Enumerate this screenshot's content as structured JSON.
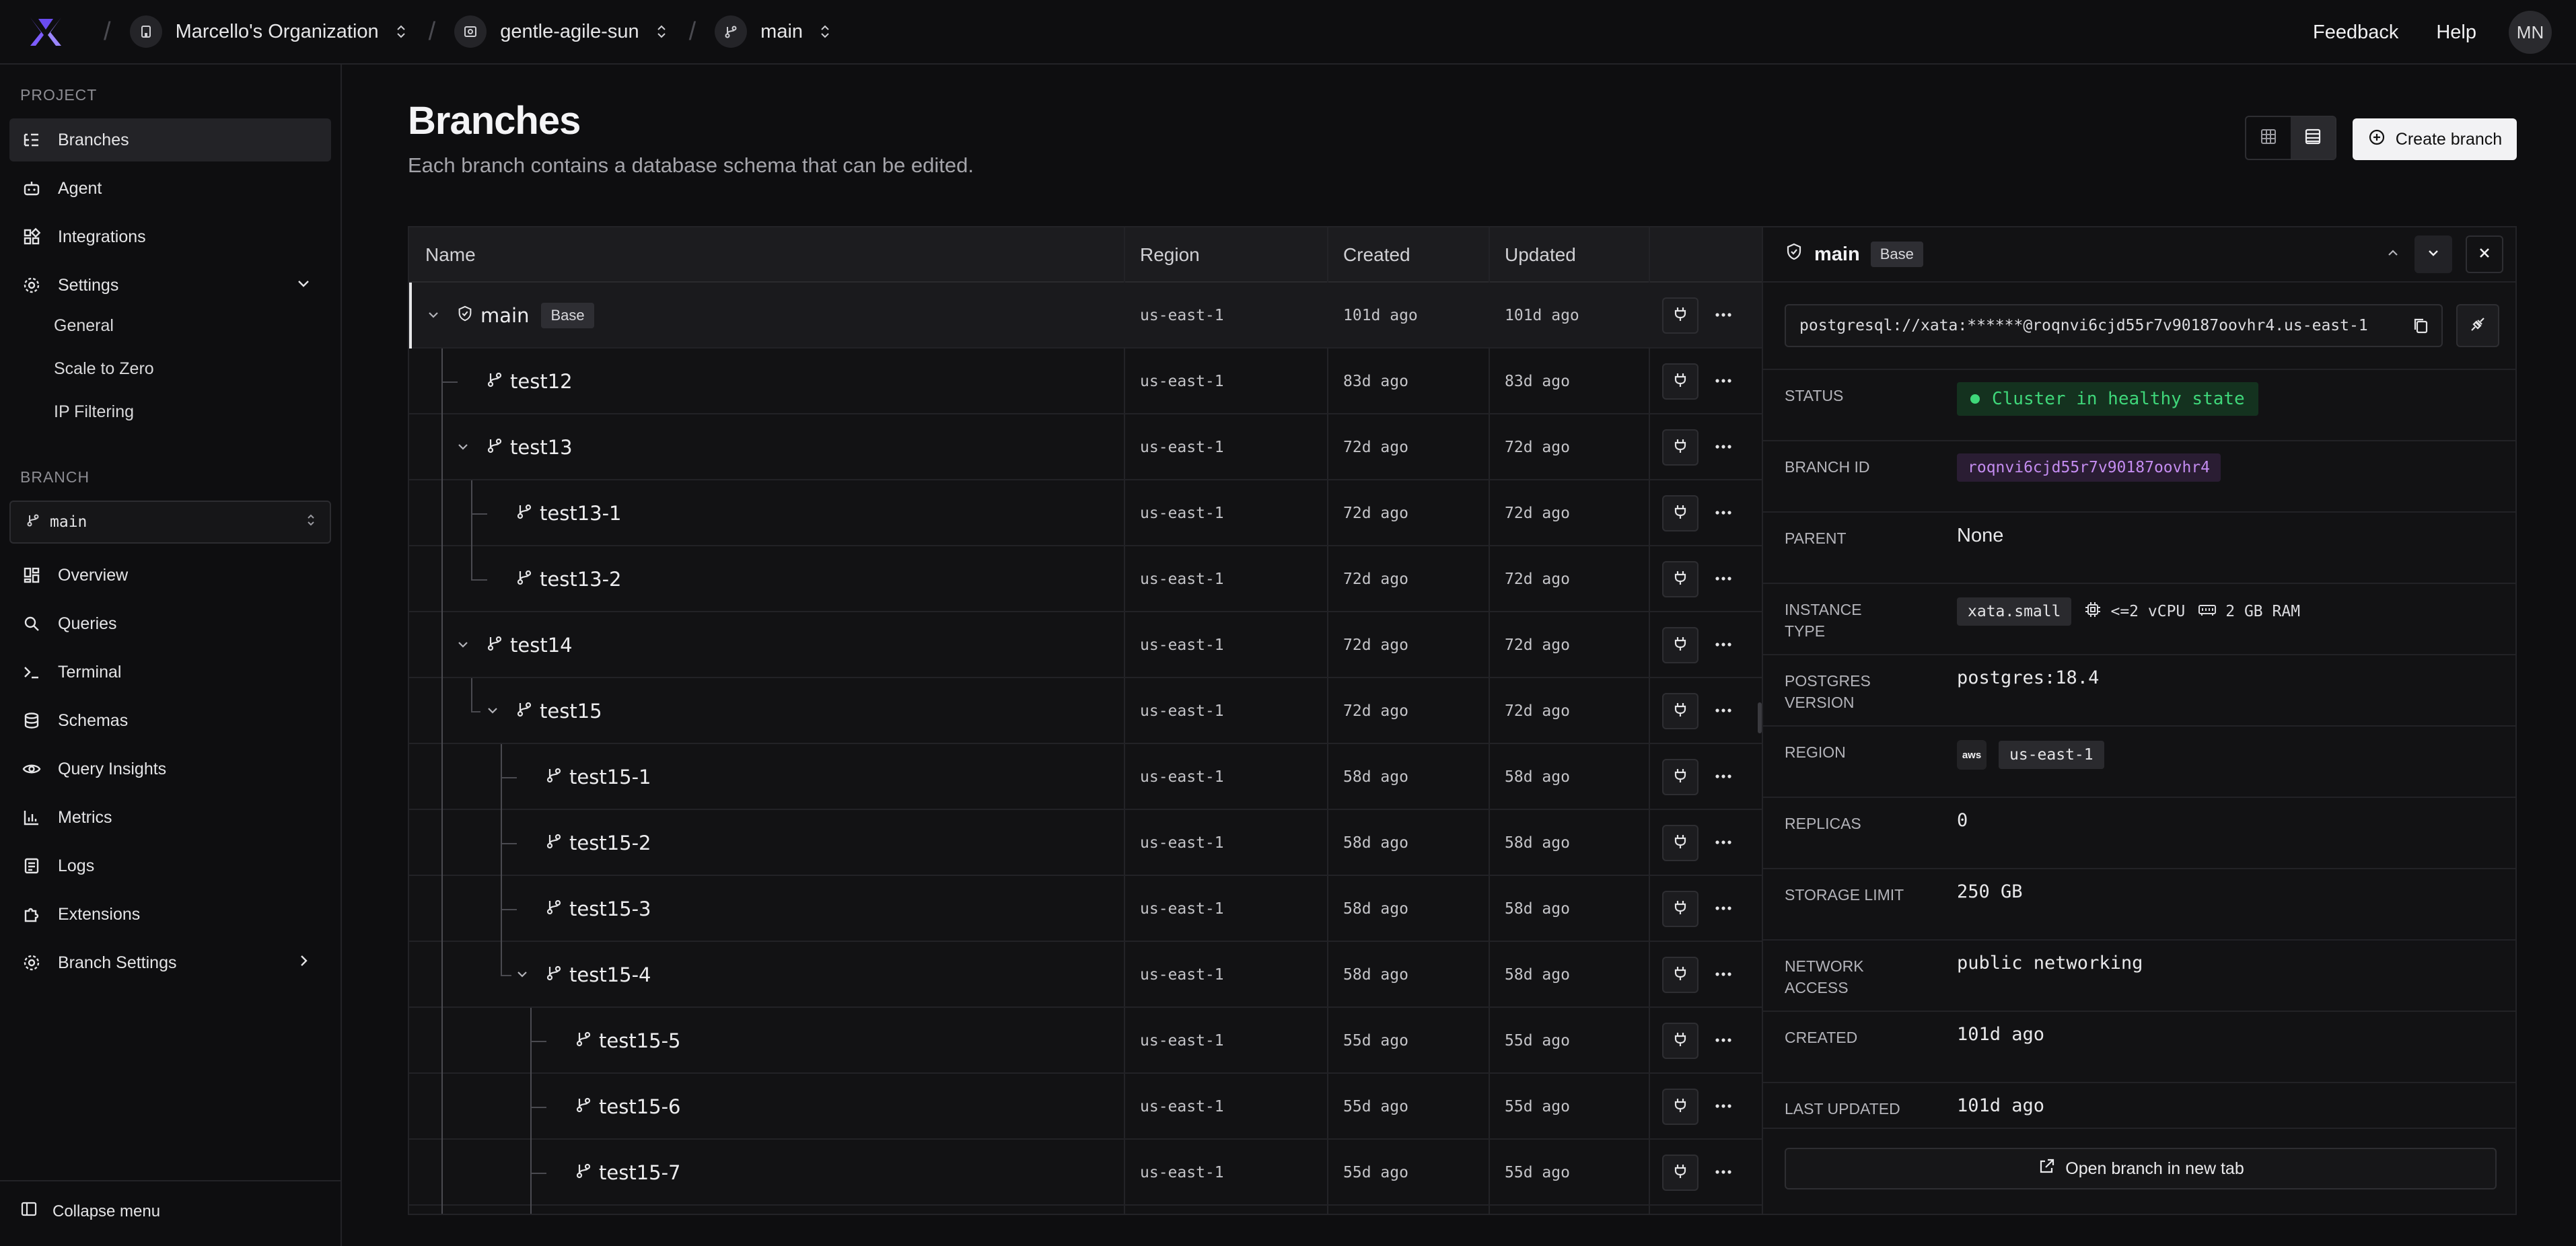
{
  "topbar": {
    "org": "Marcello's Organization",
    "project": "gentle-agile-sun",
    "branch": "main",
    "feedback": "Feedback",
    "help": "Help",
    "avatar_initials": "MN"
  },
  "sidebar": {
    "project_section": "PROJECT",
    "project_items": [
      {
        "label": "Branches",
        "icon": "branches-icon"
      },
      {
        "label": "Agent",
        "icon": "robot-icon"
      },
      {
        "label": "Integrations",
        "icon": "integrations-icon"
      },
      {
        "label": "Settings",
        "icon": "gear-icon"
      }
    ],
    "settings_sub": [
      "General",
      "Scale to Zero",
      "IP Filtering"
    ],
    "branch_section": "BRANCH",
    "branch_select": "main",
    "branch_items": [
      {
        "label": "Overview",
        "icon": "dashboard-icon"
      },
      {
        "label": "Queries",
        "icon": "search-icon"
      },
      {
        "label": "Terminal",
        "icon": "terminal-icon"
      },
      {
        "label": "Schemas",
        "icon": "database-icon"
      },
      {
        "label": "Query Insights",
        "icon": "eye-icon"
      },
      {
        "label": "Metrics",
        "icon": "bar-chart-icon"
      },
      {
        "label": "Logs",
        "icon": "logs-icon"
      },
      {
        "label": "Extensions",
        "icon": "puzzle-icon"
      },
      {
        "label": "Branch Settings",
        "icon": "gear-icon"
      }
    ],
    "collapse": "Collapse menu"
  },
  "main": {
    "title": "Branches",
    "subtitle": "Each branch contains a database schema that can be edited.",
    "create_button": "Create branch"
  },
  "table": {
    "headers": [
      "Name",
      "Region",
      "Created",
      "Updated"
    ],
    "rows": [
      {
        "name": "main",
        "tag": "Base",
        "region": "us-east-1",
        "created": "101d ago",
        "updated": "101d ago"
      },
      {
        "name": "test12",
        "region": "us-east-1",
        "created": "83d ago",
        "updated": "83d ago"
      },
      {
        "name": "test13",
        "region": "us-east-1",
        "created": "72d ago",
        "updated": "72d ago"
      },
      {
        "name": "test13-1",
        "region": "us-east-1",
        "created": "72d ago",
        "updated": "72d ago"
      },
      {
        "name": "test13-2",
        "region": "us-east-1",
        "created": "72d ago",
        "updated": "72d ago"
      },
      {
        "name": "test14",
        "region": "us-east-1",
        "created": "72d ago",
        "updated": "72d ago"
      },
      {
        "name": "test15",
        "region": "us-east-1",
        "created": "72d ago",
        "updated": "72d ago"
      },
      {
        "name": "test15-1",
        "region": "us-east-1",
        "created": "58d ago",
        "updated": "58d ago"
      },
      {
        "name": "test15-2",
        "region": "us-east-1",
        "created": "58d ago",
        "updated": "58d ago"
      },
      {
        "name": "test15-3",
        "region": "us-east-1",
        "created": "58d ago",
        "updated": "58d ago"
      },
      {
        "name": "test15-4",
        "region": "us-east-1",
        "created": "58d ago",
        "updated": "58d ago"
      },
      {
        "name": "test15-5",
        "region": "us-east-1",
        "created": "55d ago",
        "updated": "55d ago"
      },
      {
        "name": "test15-6",
        "region": "us-east-1",
        "created": "55d ago",
        "updated": "55d ago"
      },
      {
        "name": "test15-7",
        "region": "us-east-1",
        "created": "55d ago",
        "updated": "55d ago"
      }
    ]
  },
  "panel": {
    "branch": "main",
    "tag": "Base",
    "connection": "postgresql://xata:******@roqnvi6cjd55r7v90187oovhr4.us-east-1",
    "status_label": "STATUS",
    "status_value": "Cluster in healthy state",
    "branch_id_label": "BRANCH ID",
    "branch_id": "roqnvi6cjd55r7v90187oovhr4",
    "parent_label": "PARENT",
    "parent": "None",
    "instance_label_1": "INSTANCE",
    "instance_label_2": "TYPE",
    "instance_type": "xata.small",
    "vcpu": "<=2 vCPU",
    "ram": "2 GB RAM",
    "pg_label_1": "POSTGRES",
    "pg_label_2": "VERSION",
    "pg_version": "postgres:18.4",
    "region_label": "REGION",
    "aws_logo": "aws",
    "region": "us-east-1",
    "replicas_label": "REPLICAS",
    "replicas": "0",
    "storage_label": "STORAGE LIMIT",
    "storage": "250 GB",
    "network_label_1": "NETWORK",
    "network_label_2": "ACCESS",
    "network": "public networking",
    "created_label": "CREATED",
    "created": "101d ago",
    "updated_label": "LAST UPDATED",
    "updated": "101d ago",
    "open_button": "Open branch in new tab"
  },
  "colors": {
    "accent_logo": "#7c5cff",
    "status_green": "#3fd77a",
    "branch_id_purple": "#c48cf0",
    "background": "#0e0e10"
  }
}
